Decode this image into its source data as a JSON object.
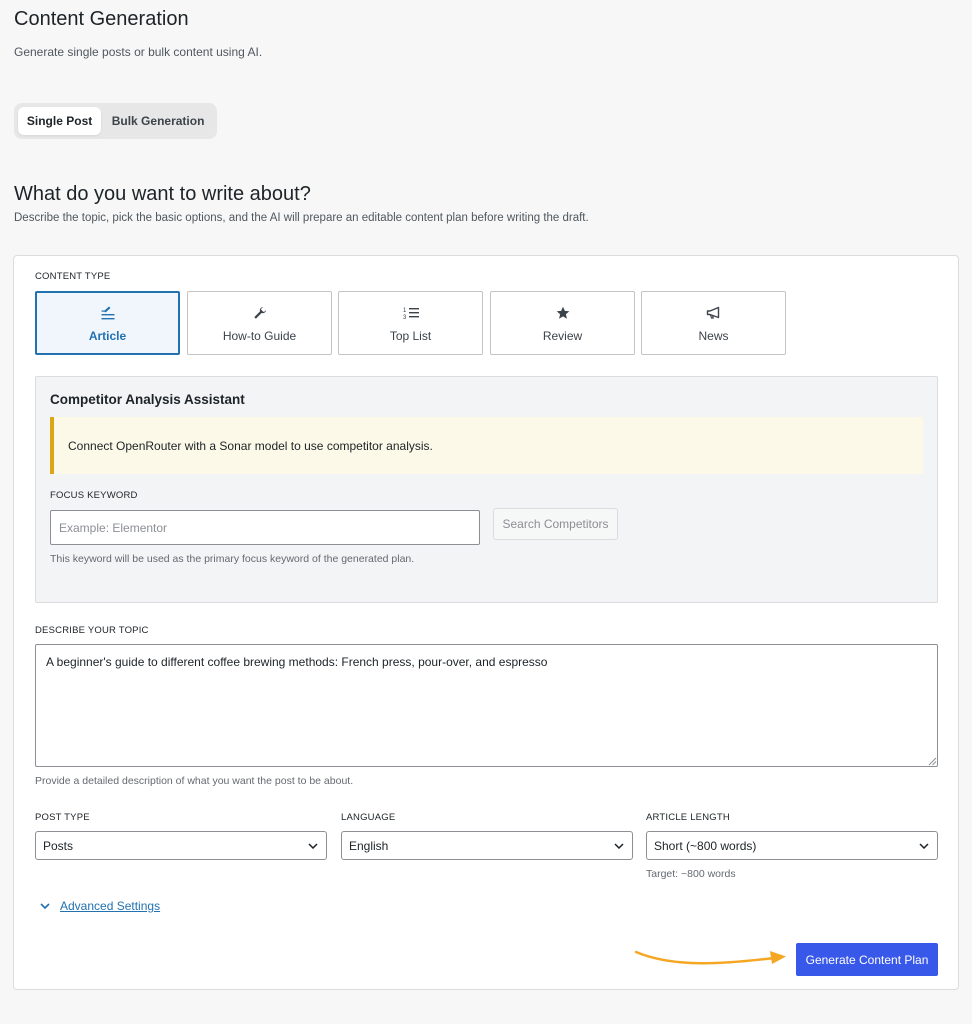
{
  "header": {
    "title": "Content Generation",
    "subtitle": "Generate single posts or bulk content using AI."
  },
  "mode_tabs": [
    {
      "label": "Single Post",
      "active": true
    },
    {
      "label": "Bulk Generation",
      "active": false
    }
  ],
  "section": {
    "title": "What do you want to write about?",
    "description": "Describe the topic, pick the basic options, and the AI will prepare an editable content plan before writing the draft."
  },
  "content_type": {
    "label": "CONTENT TYPE",
    "selected": "Article",
    "options": [
      {
        "label": "Article",
        "icon": "article-icon"
      },
      {
        "label": "How-to Guide",
        "icon": "wrench-icon"
      },
      {
        "label": "Top List",
        "icon": "numbered-list-icon"
      },
      {
        "label": "Review",
        "icon": "star-icon"
      },
      {
        "label": "News",
        "icon": "megaphone-icon"
      }
    ]
  },
  "competitor": {
    "title": "Competitor Analysis Assistant",
    "notice": "Connect OpenRouter with a Sonar model to use competitor analysis.",
    "focus_label": "FOCUS KEYWORD",
    "focus_placeholder": "Example: Elementor",
    "focus_value": "",
    "search_button": "Search Competitors",
    "help": "This keyword will be used as the primary focus keyword of the generated plan."
  },
  "topic": {
    "label": "DESCRIBE YOUR TOPIC",
    "value": "A beginner's guide to different coffee brewing methods: French press, pour-over, and espresso",
    "help": "Provide a detailed description of what you want the post to be about."
  },
  "selects": {
    "post_type": {
      "label": "POST TYPE",
      "value": "Posts"
    },
    "language": {
      "label": "LANGUAGE",
      "value": "English"
    },
    "length": {
      "label": "ARTICLE LENGTH",
      "value": "Short (~800 words)",
      "help": "Target: ~800 words"
    }
  },
  "advanced_link": "Advanced Settings",
  "primary_button": "Generate Content Plan",
  "colors": {
    "accent": "#2271b1",
    "primary_button": "#3858e9",
    "notice_border": "#dba617",
    "arrow": "#f5a623"
  }
}
